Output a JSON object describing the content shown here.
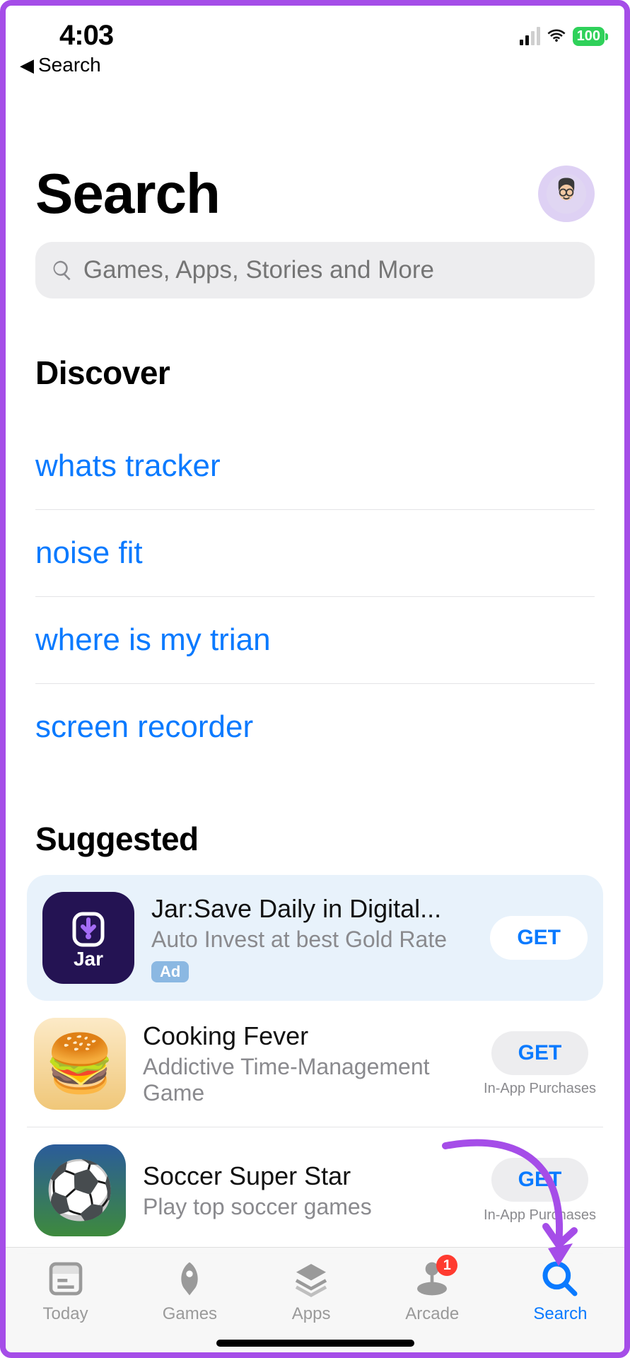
{
  "status": {
    "time": "4:03",
    "battery": "100"
  },
  "back": {
    "label": "Search"
  },
  "header": {
    "title": "Search"
  },
  "search": {
    "placeholder": "Games, Apps, Stories and More"
  },
  "discover": {
    "title": "Discover",
    "items": [
      "whats tracker",
      "noise fit",
      "where is my trian",
      "screen recorder"
    ]
  },
  "suggested": {
    "title": "Suggested",
    "ad_label": "Ad",
    "get_label": "GET",
    "iap_label": "In-App Purchases",
    "apps": [
      {
        "name": "Jar:Save Daily in Digital...",
        "subtitle": "Auto Invest at best Gold Rate",
        "is_ad": true,
        "iap": false,
        "icon": "jar"
      },
      {
        "name": "Cooking Fever",
        "subtitle": "Addictive Time-Management Game",
        "is_ad": false,
        "iap": true,
        "icon": "cook"
      },
      {
        "name": "Soccer Super Star",
        "subtitle": "Play top soccer games",
        "is_ad": false,
        "iap": true,
        "icon": "soccer"
      }
    ]
  },
  "tabs": {
    "items": [
      {
        "label": "Today",
        "icon": "today",
        "active": false
      },
      {
        "label": "Games",
        "icon": "games",
        "active": false
      },
      {
        "label": "Apps",
        "icon": "apps",
        "active": false
      },
      {
        "label": "Arcade",
        "icon": "arcade",
        "active": false,
        "badge": "1"
      },
      {
        "label": "Search",
        "icon": "search",
        "active": true
      }
    ]
  }
}
